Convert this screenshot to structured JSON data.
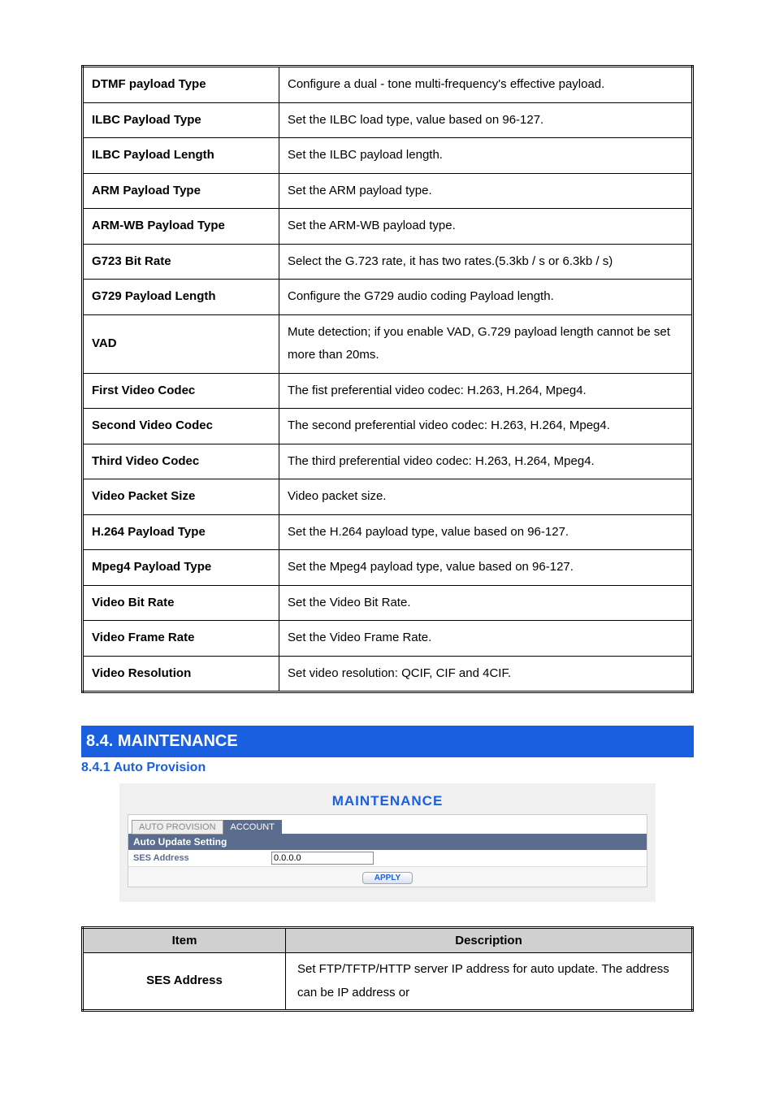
{
  "rows": [
    {
      "label": "DTMF payload Type",
      "desc": "Configure a dual - tone multi-frequency's effective payload."
    },
    {
      "label": "ILBC Payload Type",
      "desc": "Set the ILBC load type, value based on 96-127."
    },
    {
      "label": "ILBC Payload Length",
      "desc": "Set the ILBC payload length."
    },
    {
      "label": "ARM Payload Type",
      "desc": "Set the ARM payload type."
    },
    {
      "label": "ARM-WB Payload Type",
      "desc": "Set the ARM-WB payload type."
    },
    {
      "label": "G723 Bit Rate",
      "desc": "Select the G.723 rate, it has two rates.(5.3kb / s or 6.3kb / s)"
    },
    {
      "label": "G729 Payload Length",
      "desc": "Configure the G729 audio coding Payload length."
    },
    {
      "label": "VAD",
      "desc": "Mute detection; if you enable VAD, G.729 payload length cannot be set more than 20ms."
    },
    {
      "label": "First Video Codec",
      "desc": "The fist preferential video codec: H.263, H.264, Mpeg4."
    },
    {
      "label": "Second Video Codec",
      "desc": "The second preferential video codec: H.263, H.264, Mpeg4."
    },
    {
      "label": "Third Video Codec",
      "desc": "The third preferential video codec: H.263, H.264, Mpeg4."
    },
    {
      "label": "Video Packet Size",
      "desc": "Video packet size."
    },
    {
      "label": "H.264 Payload Type",
      "desc": "Set the H.264 payload type, value based on 96-127."
    },
    {
      "label": "Mpeg4 Payload Type",
      "desc": "Set the Mpeg4 payload type, value based on 96-127."
    },
    {
      "label": "Video Bit Rate",
      "desc": "Set the Video Bit Rate."
    },
    {
      "label": "Video Frame Rate",
      "desc": "Set the Video Frame Rate."
    },
    {
      "label": "Video Resolution",
      "desc": "Set video resolution: QCIF, CIF and 4CIF."
    }
  ],
  "section": "8.4. MAINTENANCE",
  "subsection": "8.4.1 Auto Provision",
  "maint": {
    "title": "MAINTENANCE",
    "tab1": "AUTO PROVISION",
    "tab2": "ACCOUNT",
    "panel_header": "Auto Update Setting",
    "ses_label": "SES Address",
    "ses_value": "0.0.0.0",
    "apply": "APPLY"
  },
  "desc_table": {
    "h1": "Item",
    "h2": "Description",
    "row1_label": "SES Address",
    "row1_desc": "Set FTP/TFTP/HTTP server IP address for auto update. The address can be IP address or"
  }
}
